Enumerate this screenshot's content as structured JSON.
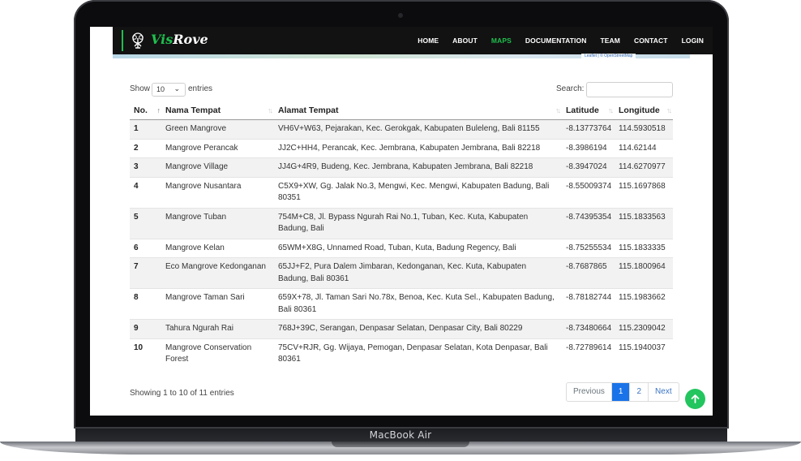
{
  "device": {
    "label": "MacBook Air"
  },
  "brand": {
    "logo_prefix": "Vis",
    "logo_suffix": "Rove",
    "accent_color": "#1fbf4e"
  },
  "nav": {
    "items": [
      {
        "label": "HOME",
        "active": false
      },
      {
        "label": "ABOUT",
        "active": false
      },
      {
        "label": "MAPS",
        "active": true
      },
      {
        "label": "DOCUMENTATION",
        "active": false
      },
      {
        "label": "TEAM",
        "active": false
      },
      {
        "label": "CONTACT",
        "active": false
      },
      {
        "label": "LOGIN",
        "active": false
      }
    ]
  },
  "map": {
    "attribution": "Leaflet | © OpenStreetMap"
  },
  "table_controls": {
    "show_label": "Show",
    "entries_value": "10",
    "entries_label": "entries",
    "search_label": "Search:",
    "search_value": ""
  },
  "table": {
    "columns": [
      "No.",
      "Nama Tempat",
      "Alamat Tempat",
      "Latitude",
      "Longitude"
    ],
    "rows": [
      {
        "no": "1",
        "name": "Green Mangrove",
        "address": "VH6V+W63, Pejarakan, Kec. Gerokgak, Kabupaten Buleleng, Bali 81155",
        "lat": "-8.13773764",
        "lng": "114.5930518"
      },
      {
        "no": "2",
        "name": "Mangrove Perancak",
        "address": "JJ2C+HH4, Perancak, Kec. Jembrana, Kabupaten Jembrana, Bali 82218",
        "lat": "-8.3986194",
        "lng": "114.62144"
      },
      {
        "no": "3",
        "name": "Mangrove Village",
        "address": "JJ4G+4R9, Budeng, Kec. Jembrana, Kabupaten Jembrana, Bali 82218",
        "lat": "-8.3947024",
        "lng": "114.6270977"
      },
      {
        "no": "4",
        "name": "Mangrove Nusantara",
        "address": "C5X9+XW, Gg. Jalak No.3, Mengwi, Kec. Mengwi, Kabupaten Badung, Bali 80351",
        "lat": "-8.55009374",
        "lng": "115.1697868"
      },
      {
        "no": "5",
        "name": "Mangrove Tuban",
        "address": "754M+C8, Jl. Bypass Ngurah Rai No.1, Tuban, Kec. Kuta, Kabupaten Badung, Bali",
        "lat": "-8.74395354",
        "lng": "115.1833563"
      },
      {
        "no": "6",
        "name": "Mangrove Kelan",
        "address": "65WM+X8G, Unnamed Road, Tuban, Kuta, Badung Regency, Bali",
        "lat": "-8.75255534",
        "lng": "115.1833335"
      },
      {
        "no": "7",
        "name": "Eco Mangrove Kedonganan",
        "address": "65JJ+F2, Pura Dalem Jimbaran, Kedonganan, Kec. Kuta, Kabupaten Badung, Bali 80361",
        "lat": "-8.7687865",
        "lng": "115.1800964"
      },
      {
        "no": "8",
        "name": "Mangrove Taman Sari",
        "address": "659X+78, Jl. Taman Sari No.78x, Benoa, Kec. Kuta Sel., Kabupaten Badung, Bali 80361",
        "lat": "-8.78182744",
        "lng": "115.1983662"
      },
      {
        "no": "9",
        "name": "Tahura Ngurah Rai",
        "address": "768J+39C, Serangan, Denpasar Selatan, Denpasar City, Bali 80229",
        "lat": "-8.73480664",
        "lng": "115.2309042"
      },
      {
        "no": "10",
        "name": "Mangrove Conservation Forest",
        "address": "75CV+RJR, Gg. Wijaya, Pemogan, Denpasar Selatan, Kota Denpasar, Bali 80361",
        "lat": "-8.72789614",
        "lng": "115.1940037"
      }
    ]
  },
  "footer": {
    "info": "Showing 1 to 10 of 11 entries",
    "pagination": {
      "previous": "Previous",
      "pages": [
        "1",
        "2"
      ],
      "current": "1",
      "next": "Next"
    }
  },
  "icons": {
    "scroll_top": "arrow-up-icon",
    "logo": "tree-icon",
    "select_chevron": "chevron-down-icon"
  }
}
